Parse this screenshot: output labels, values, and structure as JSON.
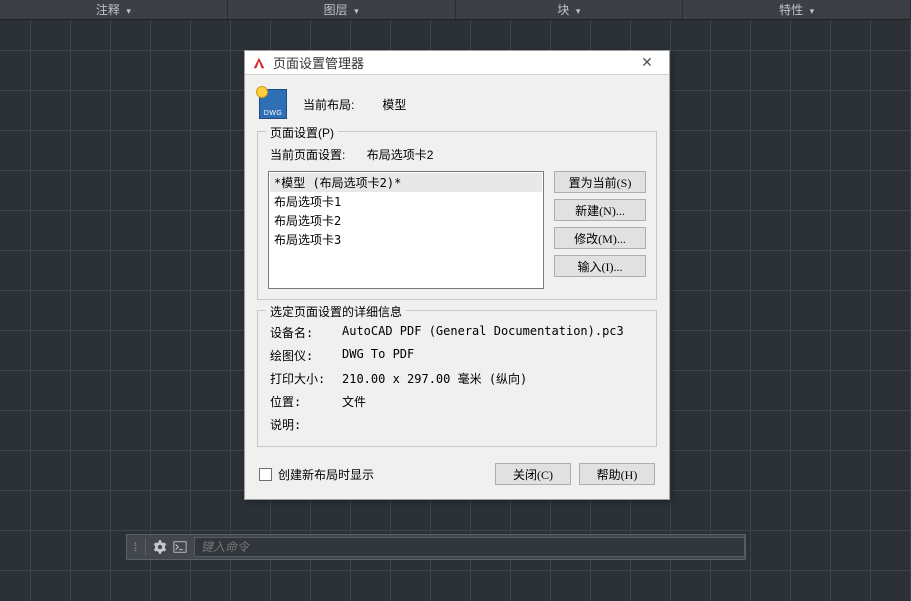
{
  "ribbon": {
    "tabs": [
      "注释",
      "图层",
      "块",
      "特性"
    ]
  },
  "dialog": {
    "title": "页面设置管理器",
    "dwg_icon_text": "DWG",
    "current_layout_label": "当前布局:",
    "current_layout_value": "模型",
    "page_setup_group": "页面设置(P)",
    "current_setup_label": "当前页面设置:",
    "current_setup_value": "布局选项卡2",
    "setups": [
      "*模型 (布局选项卡2)*",
      "布局选项卡1",
      "布局选项卡2",
      "布局选项卡3"
    ],
    "buttons": {
      "set_current": "置为当前(S)",
      "new": "新建(N)...",
      "modify": "修改(M)...",
      "import": "输入(I)..."
    },
    "detail_group": "选定页面设置的详细信息",
    "details": {
      "device_label": "设备名:",
      "device_value": "AutoCAD PDF (General Documentation).pc3",
      "plotter_label": "绘图仪:",
      "plotter_value": "DWG To PDF",
      "size_label": "打印大小:",
      "size_value": "210.00 x 297.00 毫米 (纵向)",
      "location_label": "位置:",
      "location_value": "文件",
      "desc_label": "说明:",
      "desc_value": ""
    },
    "show_on_new_layout": "创建新布局时显示",
    "close": "关闭(C)",
    "help": "帮助(H)"
  },
  "commandbar": {
    "placeholder": "键入命令"
  }
}
